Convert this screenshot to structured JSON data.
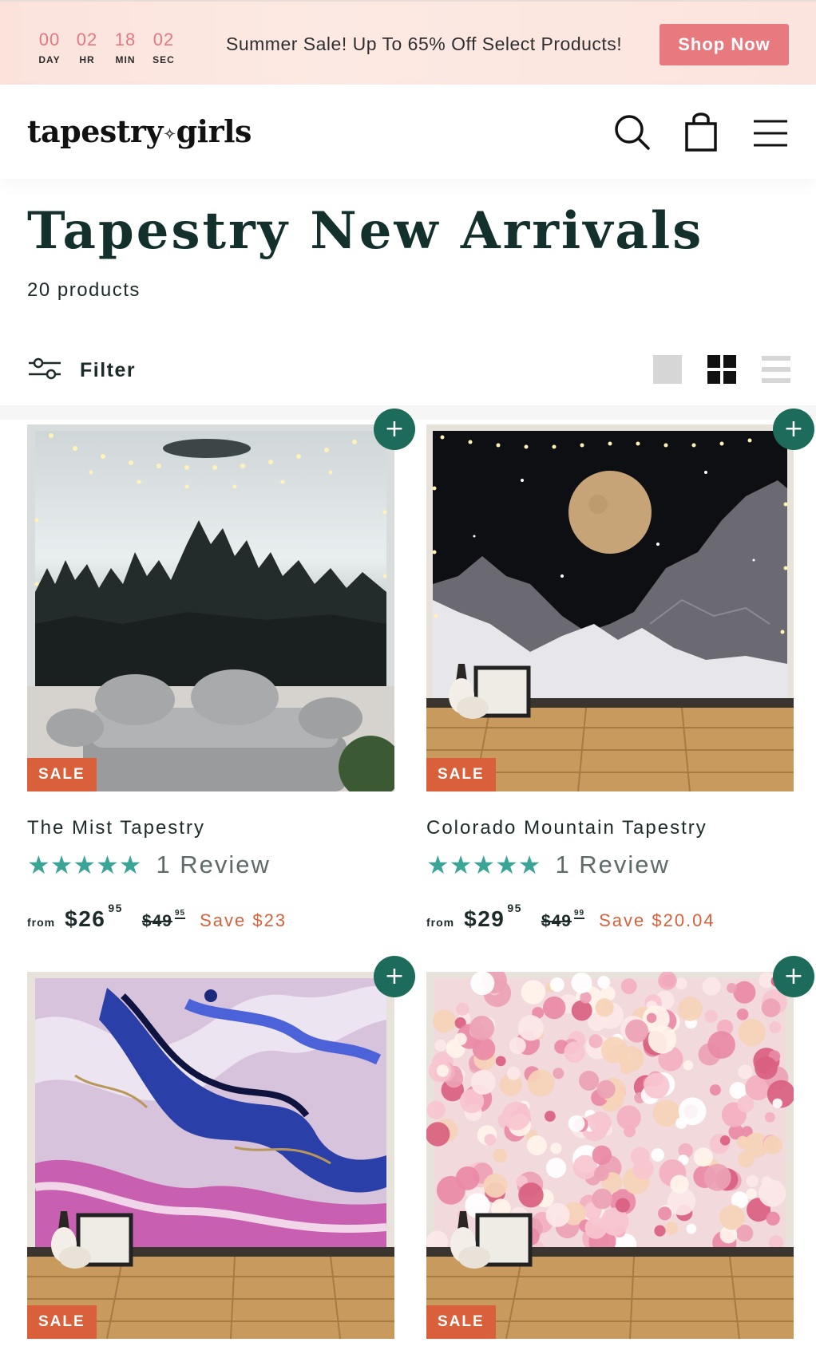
{
  "countdown": [
    {
      "value": "00",
      "unit": "DAY"
    },
    {
      "value": "02",
      "unit": "HR"
    },
    {
      "value": "18",
      "unit": "MIN"
    },
    {
      "value": "02",
      "unit": "SEC"
    }
  ],
  "announcement": {
    "text": "Summer Sale! Up To 65% Off Select Products!",
    "cta": "Shop Now"
  },
  "header": {
    "logo_left": "tapestry",
    "logo_right": "girls",
    "icons": [
      "search-icon",
      "cart-icon",
      "menu-icon"
    ]
  },
  "collection": {
    "title": "Tapestry New Arrivals",
    "count": "20 products",
    "filter_label": "Filter",
    "view_modes": [
      "large-grid",
      "small-grid",
      "list"
    ],
    "active_view": "small-grid"
  },
  "products": [
    {
      "name": "The Mist Tapestry",
      "badge": "SALE",
      "rating": 5,
      "reviews": "1 Review",
      "from": "from",
      "price_dollars": "$26",
      "price_cents": "95",
      "was_dollars": "$49",
      "was_cents": "95",
      "save": "Save $23"
    },
    {
      "name": "Colorado Mountain Tapestry",
      "badge": "SALE",
      "rating": 5,
      "reviews": "1 Review",
      "from": "from",
      "price_dollars": "$29",
      "price_cents": "95",
      "was_dollars": "$49",
      "was_cents": "99",
      "save": "Save $20.04"
    },
    {
      "badge": "SALE"
    },
    {
      "badge": "SALE"
    }
  ],
  "colors": {
    "accent_pink": "#e8797f",
    "brand_green": "#1d6b5a",
    "sale_orange": "#d9603b",
    "star_teal": "#3aa597"
  }
}
